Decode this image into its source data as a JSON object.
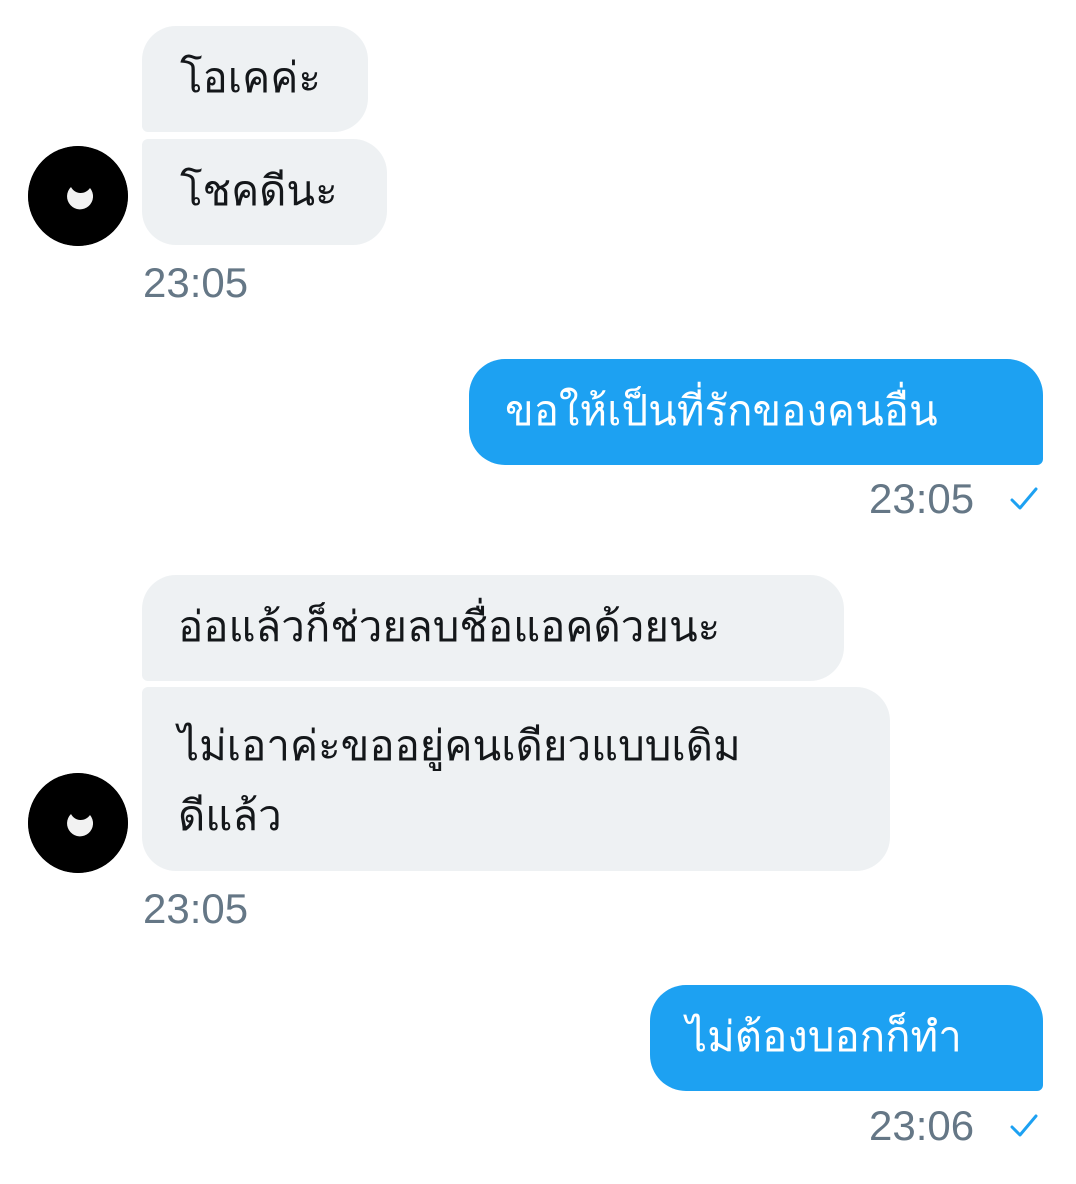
{
  "conversation": {
    "messages": [
      {
        "sender": "them",
        "lines": [
          "โอเคค่ะ"
        ]
      },
      {
        "sender": "them",
        "lines": [
          "โชคดีนะ"
        ],
        "time": "23:05"
      },
      {
        "sender": "me",
        "lines": [
          "ขอให้เป็นที่รักของคนอื่น"
        ],
        "time": "23:05"
      },
      {
        "sender": "them",
        "lines": [
          "อ่อแล้วก็ช่วยลบชื่อแอคด้วยนะ"
        ]
      },
      {
        "sender": "them",
        "lines": [
          "ไม่เอาค่ะขออยู่คนเดียวแบบเดิม",
          "ดีแล้ว"
        ],
        "time": "23:05"
      },
      {
        "sender": "me",
        "lines": [
          "ไม่ต้องบอกก็ทำ"
        ],
        "time": "23:06"
      }
    ]
  },
  "colors": {
    "incoming_bubble": "#eef1f3",
    "outgoing_bubble": "#1da1f2",
    "timestamp": "#657786",
    "read_check": "#1da1f2"
  },
  "icons": {
    "avatar": "black-circle-crescent-moon",
    "read_receipt": "checkmark-icon"
  }
}
